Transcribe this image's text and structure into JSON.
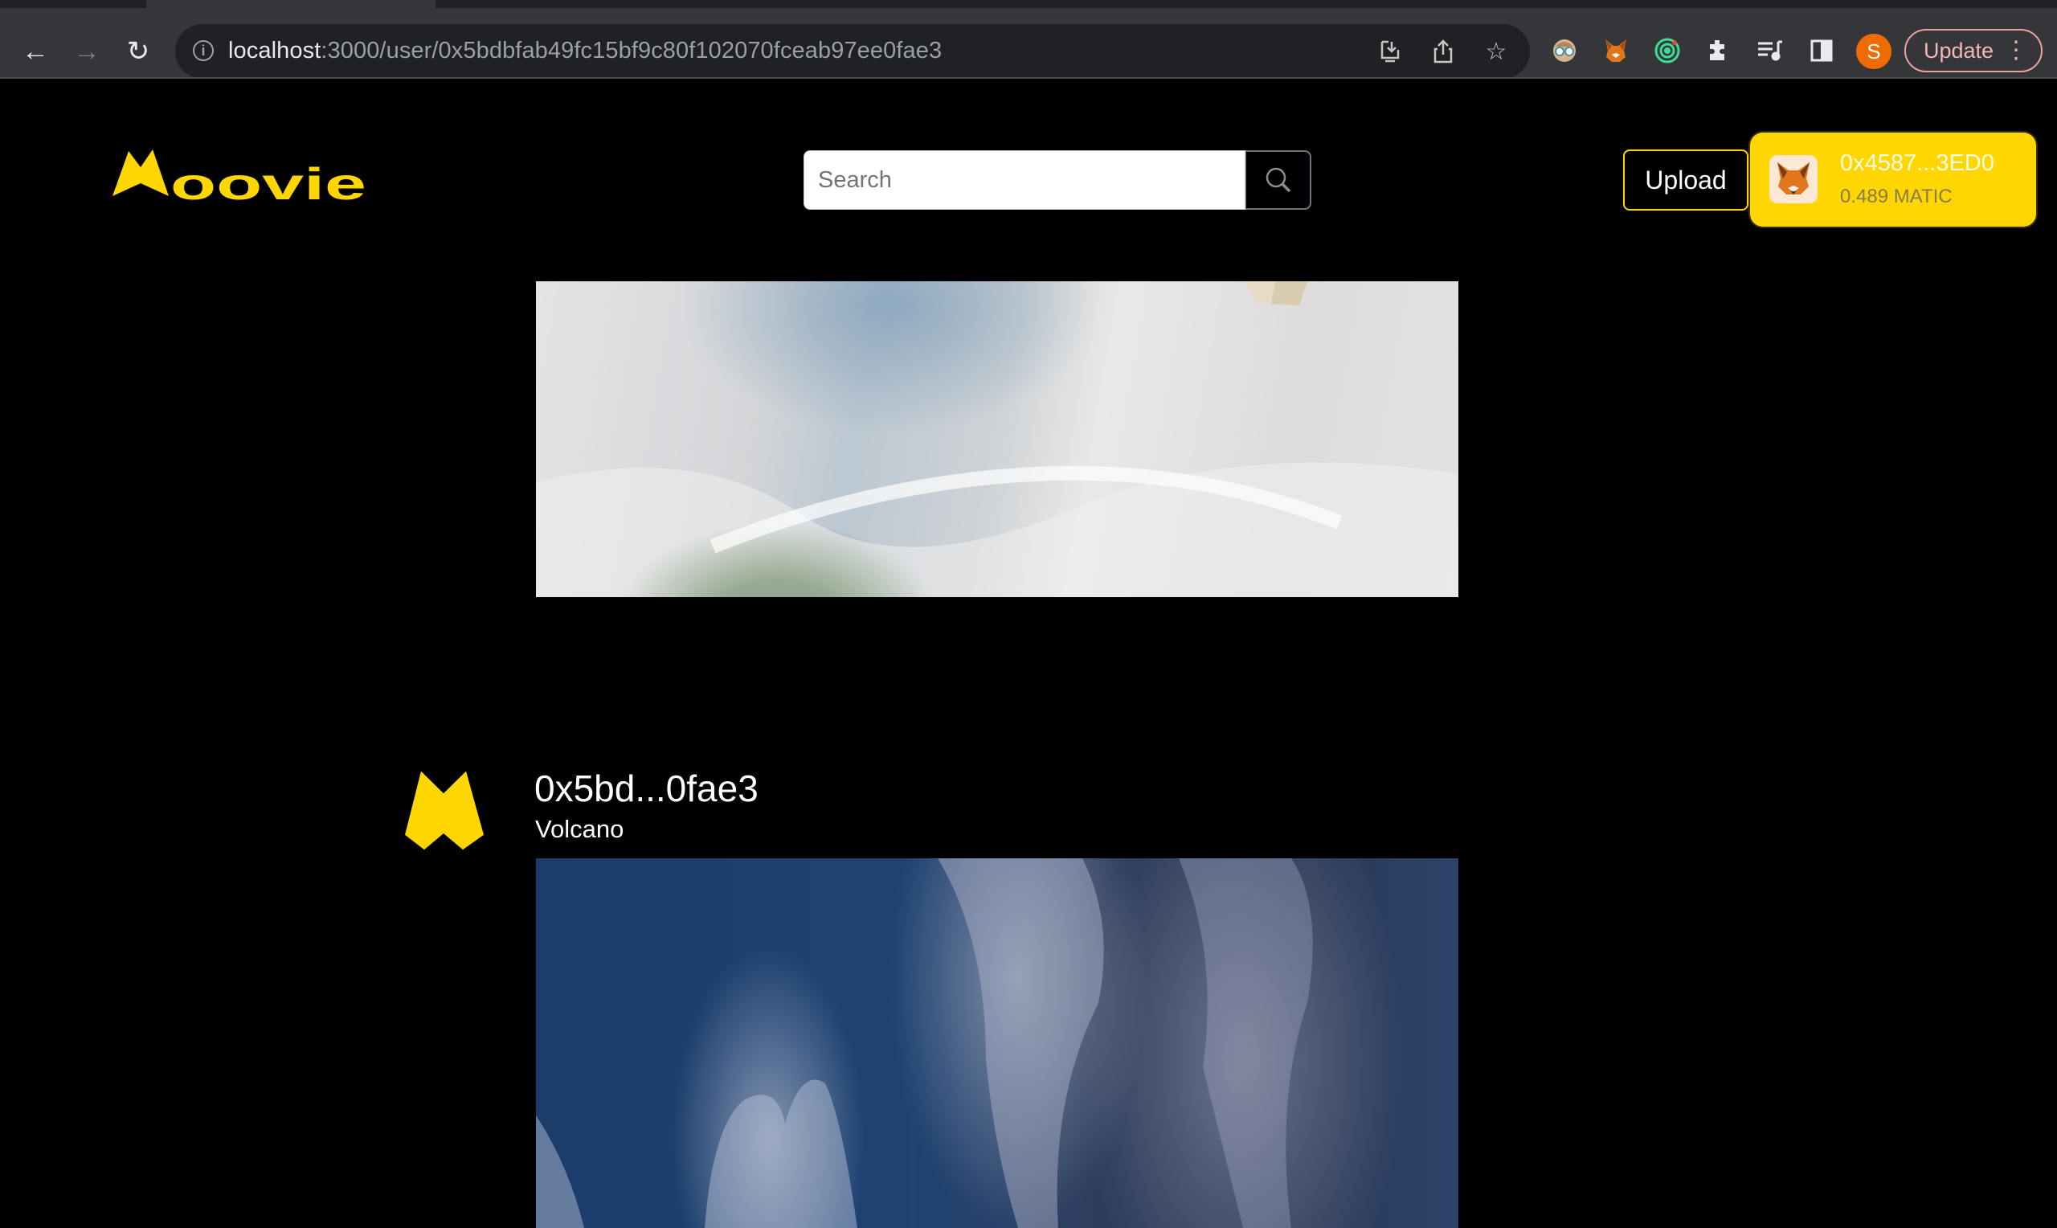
{
  "browser": {
    "url_host": "localhost",
    "url_path": ":3000/user/0x5bdbfab49fc15bf9c80f102070fceab97ee0fae3",
    "profile_initial": "S",
    "update_label": "Update",
    "icons": {
      "back": "←",
      "forward": "→",
      "reload": "↻",
      "info": "i",
      "install": "⇩",
      "share": "⇪",
      "bookmark": "☆",
      "extensions": "✱",
      "media": "≡♪",
      "sidepanel": "▯",
      "menu": "⋮"
    }
  },
  "header": {
    "logo_text": "oovie",
    "search_placeholder": "Search",
    "upload_label": "Upload",
    "wallet": {
      "address": "0x4587...3ED0",
      "balance": "0.489 MATIC"
    }
  },
  "feed": [
    {
      "kind": "video",
      "title": "",
      "subtitle": ""
    },
    {
      "kind": "video",
      "author": "0x5bd...0fae3",
      "title": "Volcano"
    }
  ],
  "colors": {
    "brand_yellow": "#ffd600",
    "page_bg": "#000000",
    "chrome_bg": "#35363a",
    "update_accent": "#f2b8b5"
  }
}
